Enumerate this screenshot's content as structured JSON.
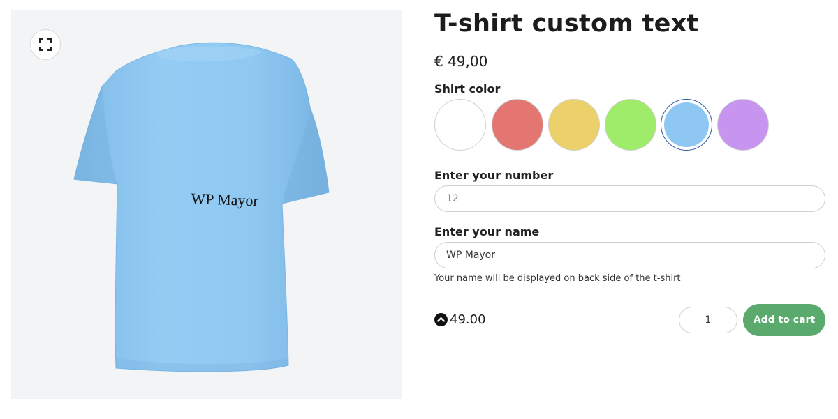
{
  "viewer": {
    "fullscreen_icon": "fullscreen-icon",
    "shirt_color": "#8ec7f2",
    "shirt_text": "WP Mayor"
  },
  "product": {
    "title": "T-shirt custom text",
    "price": "€ 49,00"
  },
  "options": {
    "color_label": "Shirt color",
    "colors": [
      {
        "name": "white",
        "hex": "#ffffff"
      },
      {
        "name": "red",
        "hex": "#e37671"
      },
      {
        "name": "yellow",
        "hex": "#ecd06a"
      },
      {
        "name": "green",
        "hex": "#9eec6a"
      },
      {
        "name": "blue",
        "hex": "#8ec7f2",
        "selected": true
      },
      {
        "name": "purple",
        "hex": "#c795ef"
      }
    ],
    "number_label": "Enter your number",
    "number_placeholder": "12",
    "name_label": "Enter your name",
    "name_value": "WP Mayor",
    "name_help": "Your name will be displayed on back side of the t-shirt"
  },
  "cart": {
    "total_icon": "chevron-up-circle-icon",
    "total": "49.00",
    "quantity": "1",
    "add_label": "Add to cart",
    "button_color": "#5aa96d"
  }
}
